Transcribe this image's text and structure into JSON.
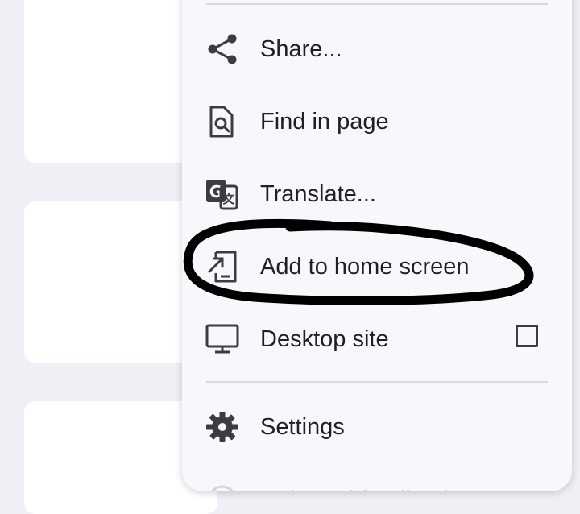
{
  "menu": {
    "items": [
      {
        "label": "Share...",
        "icon": "share-icon"
      },
      {
        "label": "Find in page",
        "icon": "find-in-page-icon"
      },
      {
        "label": "Translate...",
        "icon": "translate-icon"
      },
      {
        "label": "Add to home screen",
        "icon": "add-to-home-screen-icon"
      },
      {
        "label": "Desktop site",
        "icon": "desktop-icon",
        "checkbox_checked": false
      },
      {
        "label": "Settings",
        "icon": "gear-icon"
      },
      {
        "label": "Help and feedback",
        "icon": "help-icon"
      }
    ]
  },
  "colors": {
    "background": "#eef0f5",
    "menu": "#f7f7fc",
    "text": "#1f1f23",
    "icon": "#3c3c44",
    "annotation": "#000000"
  }
}
